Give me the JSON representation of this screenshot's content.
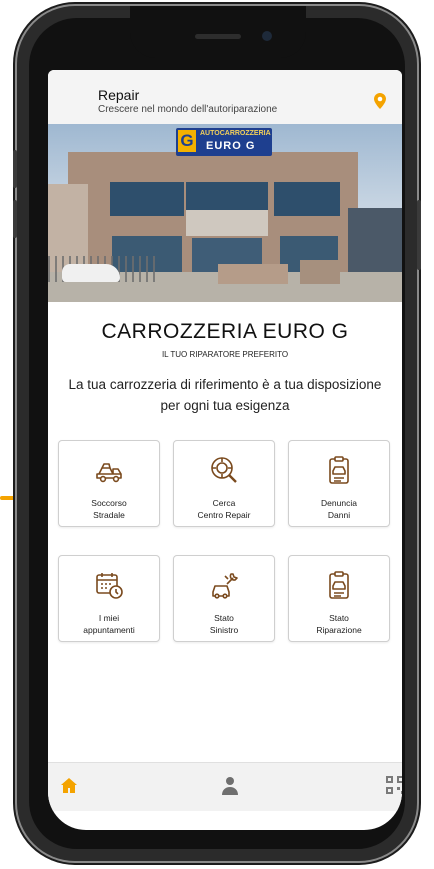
{
  "header": {
    "title": "Repair",
    "subtitle": "Crescere nel mondo dell'autoriparazione",
    "location_icon": "map-pin-icon"
  },
  "hero": {
    "sign_top": "AUTOCARROZZERIA",
    "sign_bottom": "EURO G",
    "sign_letter": "G"
  },
  "company": {
    "name": "CARROZZERIA EURO G",
    "tagline": "IL TUO RIPARATORE PREFERITO",
    "description": "La tua carrozzeria di riferimento è a tua disposizione per ogni tua esigenza"
  },
  "tiles": [
    {
      "line1": "Soccorso",
      "line2": "Stradale",
      "icon": "tow-truck-icon"
    },
    {
      "line1": "Cerca",
      "line2": "Centro Repair",
      "icon": "tire-search-icon"
    },
    {
      "line1": "Denuncia",
      "line2": "Danni",
      "icon": "clipboard-car-icon"
    },
    {
      "line1": "I miei",
      "line2": "appuntamenti",
      "icon": "calendar-clock-icon"
    },
    {
      "line1": "Stato",
      "line2": "Sinistro",
      "icon": "car-wrench-icon"
    },
    {
      "line1": "Stato",
      "line2": "Riparazione",
      "icon": "clipboard-car-icon"
    }
  ],
  "bottom_nav": {
    "items": [
      "home-icon",
      "user-icon",
      "qr-code-icon"
    ]
  },
  "colors": {
    "accent": "#f4a300",
    "icon_brown": "#7a4a1e",
    "header_bg": "#f4f4f4"
  }
}
